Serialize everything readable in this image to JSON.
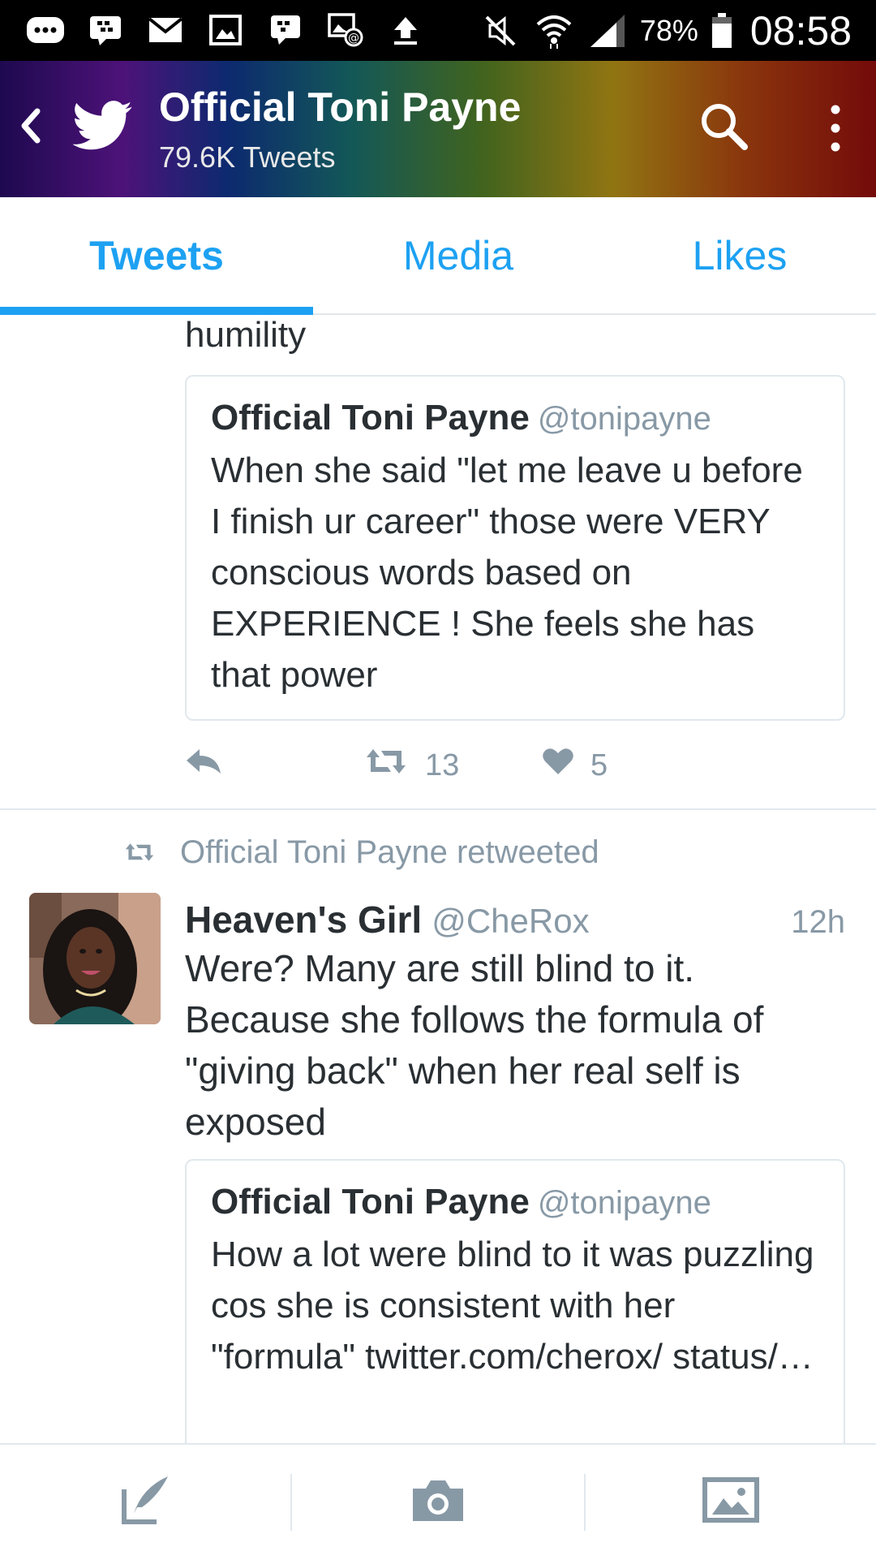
{
  "status_bar": {
    "icons": [
      "more-icon",
      "bbm-icon",
      "mail-icon",
      "gallery-icon",
      "bbm-chat-icon",
      "mms-icon",
      "upload-icon",
      "mute-icon",
      "wifi-icon",
      "signal-icon",
      "battery-icon"
    ],
    "battery": "78%",
    "time": "08:58"
  },
  "header": {
    "title": "Official Toni Payne",
    "subtitle": "79.6K Tweets"
  },
  "tabs": [
    {
      "label": "Tweets",
      "active": true
    },
    {
      "label": "Media",
      "active": false
    },
    {
      "label": "Likes",
      "active": false
    }
  ],
  "feed": {
    "tweet1": {
      "text_fragment": "humility",
      "quote": {
        "name": "Official Toni Payne",
        "handle": "@tonipayne",
        "text": "When she said \"let me leave u before I finish ur career\" those were VERY conscious words based on EXPERIENCE ! She feels she has that power"
      },
      "retweets": "13",
      "likes": "5"
    },
    "tweet2": {
      "retweet_note": "Official Toni Payne retweeted",
      "name": "Heaven's Girl",
      "handle": "@CheRox",
      "time": "12h",
      "text": "Were? Many are still blind to it. Because she follows the formula of \"giving back\" when her real self is exposed",
      "quote": {
        "name": "Official Toni Payne",
        "handle": "@tonipayne",
        "text": "How a lot were blind to it was puzzling cos she is consistent with her \"formula\"  twitter.com/cherox/ status/…"
      }
    }
  },
  "colors": {
    "twitter_blue": "#1da1f2",
    "secondary_text": "#8899a6",
    "divider": "#e1e8ed"
  }
}
